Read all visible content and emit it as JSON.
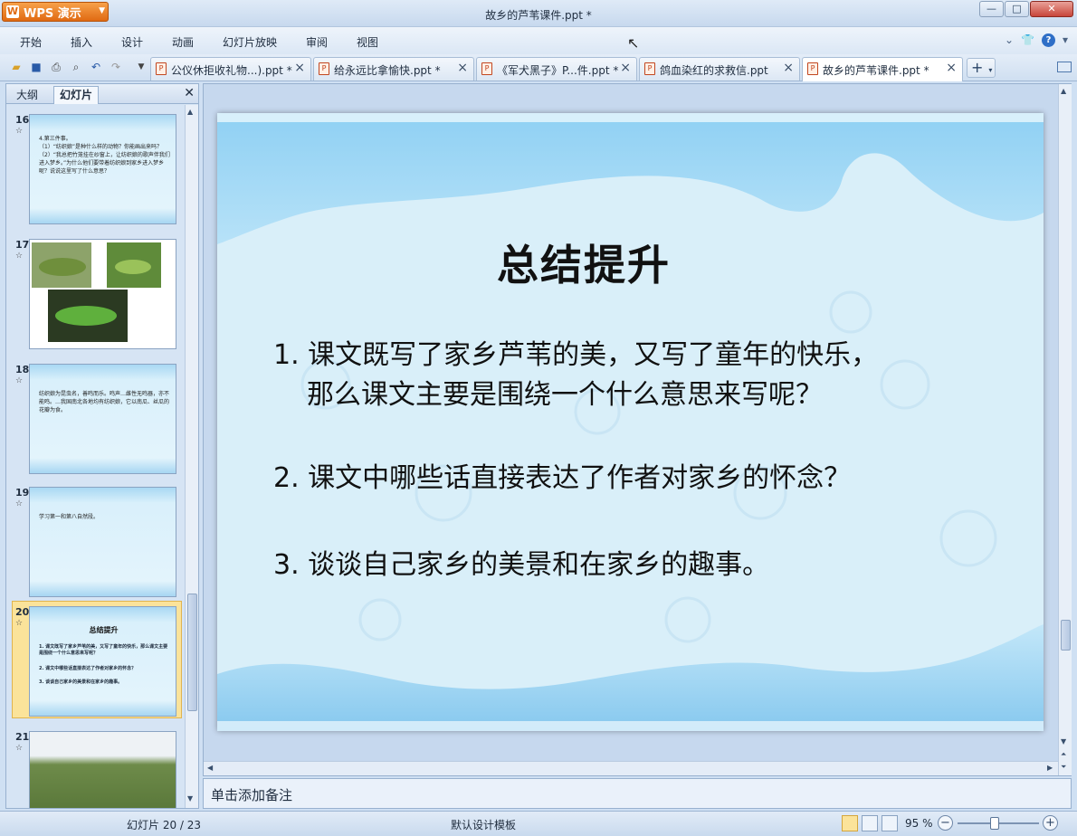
{
  "app": {
    "name": "WPS 演示",
    "window_title": "故乡的芦苇课件.ppt *"
  },
  "menu": [
    "开始",
    "插入",
    "设计",
    "动画",
    "幻灯片放映",
    "审阅",
    "视图"
  ],
  "doc_tabs": [
    {
      "label": "公仪休拒收礼物...).ppt *"
    },
    {
      "label": "给永远比拿愉快.ppt *"
    },
    {
      "label": "《军犬黑子》P...件.ppt *"
    },
    {
      "label": "鸽血染红的求救信.ppt"
    },
    {
      "label": "故乡的芦苇课件.ppt *",
      "active": true
    }
  ],
  "left_pane": {
    "tabs": [
      "大纲",
      "幻灯片"
    ],
    "active_tab": "幻灯片"
  },
  "thumbnails": [
    {
      "num": "16",
      "text": "4.第三件事。\n（1）“纺织娘”是种什么样的动物？你能画出来吗？\n（2）“我总把竹笼挂在纱窗上，让纺织娘的歌声伴我们进入梦乡。”为什么他们要带着纺织娘到家乡进入梦乡呢？说说这里写了什么意思？"
    },
    {
      "num": "17",
      "text": ""
    },
    {
      "num": "18",
      "text": "纺织娘为昆虫名，善鸣而乐。鸣声…雌性无鸣器，亦不能鸣。…我国南北各地均有纺织娘，它以南瓜、丝瓜的花瓣为食。"
    },
    {
      "num": "19",
      "text": "学习第一和第八自然段。"
    },
    {
      "num": "20",
      "selected": true,
      "title": "总结提升",
      "lines": [
        "1. 课文既写了家乡芦苇的美，又写了童年的快乐，那么课文主要是围绕一个什么意思来写呢？",
        "2. 课文中哪些话直接表达了作者对家乡的怀念？",
        "3. 谈谈自己家乡的美景和在家乡的趣事。"
      ]
    },
    {
      "num": "21",
      "text": ""
    }
  ],
  "slide": {
    "title": "总结提升",
    "questions": [
      {
        "line1": "1. 课文既写了家乡芦苇的美，又写了童年的快乐，",
        "line2": "那么课文主要是围绕一个什么意思来写呢？"
      },
      {
        "line1": "2. 课文中哪些话直接表达了作者对家乡的怀念？",
        "line2": ""
      },
      {
        "line1": "3. 谈谈自己家乡的美景和在家乡的趣事。",
        "line2": ""
      }
    ]
  },
  "notes_placeholder": "单击添加备注",
  "status": {
    "slide": "幻灯片 20 / 23",
    "template": "默认设计模板",
    "zoom": "95 %"
  },
  "colors": {
    "accent": "#e06a12",
    "selection": "#fbe39a",
    "slide_bg": "#d8eefa"
  }
}
